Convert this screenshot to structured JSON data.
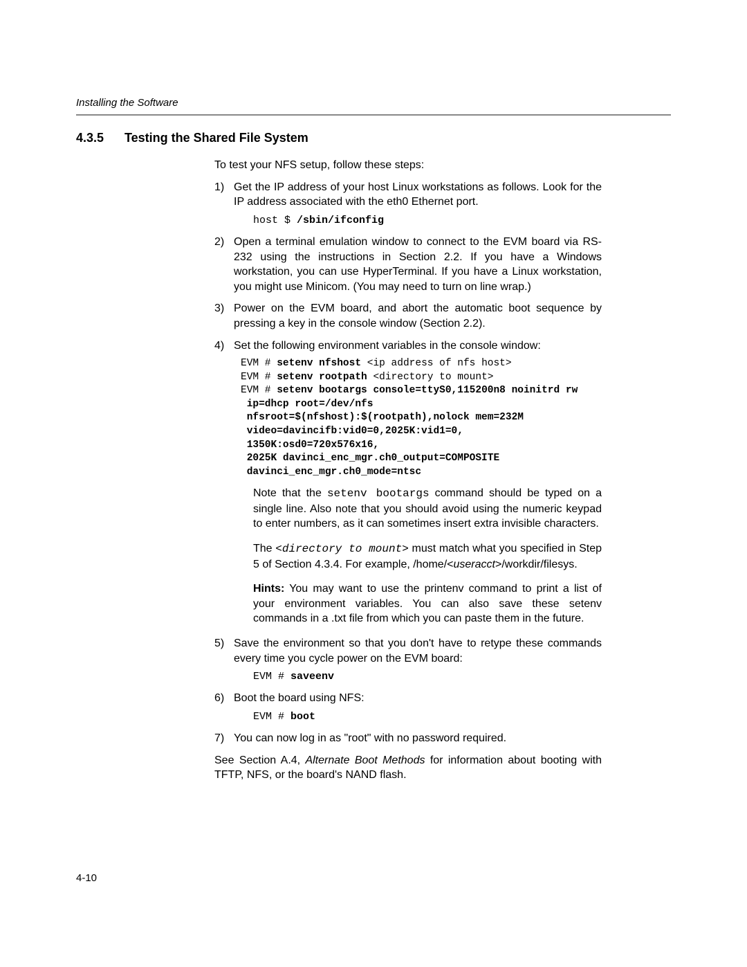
{
  "running_header": "Installing the Software",
  "section_number": "4.3.5",
  "section_title": "Testing the Shared File System",
  "intro": "To test your NFS setup, follow these steps:",
  "steps": {
    "s1": "Get the IP address of your host Linux workstations as follows. Look for the IP address associated with the eth0 Ethernet port.",
    "s1_code_prefix": "host $ ",
    "s1_code_cmd": "/sbin/ifconfig",
    "s2": "Open a terminal emulation window to connect to the EVM board via RS-232 using the instructions in Section 2.2. If you have a Windows workstation, you can use HyperTerminal. If you have a Linux workstation, you might use Minicom. (You may need to turn on line wrap.)",
    "s3": "Power on the EVM board, and abort the automatic boot sequence by pressing a key in the console window (Section 2.2).",
    "s4": "Set the following environment variables in the console window:",
    "s4_code": {
      "p1": "EVM # ",
      "c1": "setenv nfshost ",
      "a1": "<ip address of nfs host>",
      "p2": "EVM # ",
      "c2": "setenv rootpath ",
      "a2": "<directory to mount>",
      "p3": "EVM # ",
      "c3a": "setenv bootargs console=ttyS0,115200n8 noinitrd rw",
      "c3b": " ip=dhcp root=/dev/nfs",
      "c3c": " nfsroot=$(nfshost):$(rootpath),nolock mem=232M",
      "c3d": " video=davincifb:vid0=0,2025K:vid1=0,",
      "c3e": " 1350K:osd0=720x576x16,",
      "c3f": " 2025K davinci_enc_mgr.ch0_output=COMPOSITE",
      "c3g": " davinci_enc_mgr.ch0_mode=ntsc"
    },
    "s4_note1a": "Note that the ",
    "s4_note1b": "setenv bootargs",
    "s4_note1c": " command should be typed on a single line. Also note that you should avoid using the numeric keypad to enter numbers, as it can sometimes insert extra invisible characters.",
    "s4_note2a": "The ",
    "s4_note2b": "<directory to mount>",
    "s4_note2c": " must match what you specified in Step 5 of Section 4.3.4. For example, /home/<",
    "s4_note2d": "useracct",
    "s4_note2e": ">/workdir/filesys.",
    "s4_hint_label": "Hints:",
    "s4_hint_text": " You may want to use the printenv command to print a list of your environment variables. You can also save these setenv commands in a .txt file from which you can paste them in the future.",
    "s5": "Save the environment so that you don't have to retype these commands every time you cycle power on the EVM board:",
    "s5_code_prefix": "EVM # ",
    "s5_code_cmd": "saveenv",
    "s6": "Boot the board using NFS:",
    "s6_code_prefix": "EVM # ",
    "s6_code_cmd": "boot",
    "s7": "You can now log in as \"root\" with no password required."
  },
  "closing_a": "See Section A.4, ",
  "closing_b": "Alternate Boot Methods",
  "closing_c": " for information about booting with TFTP, NFS, or the board's NAND flash.",
  "page_number": "4-10"
}
